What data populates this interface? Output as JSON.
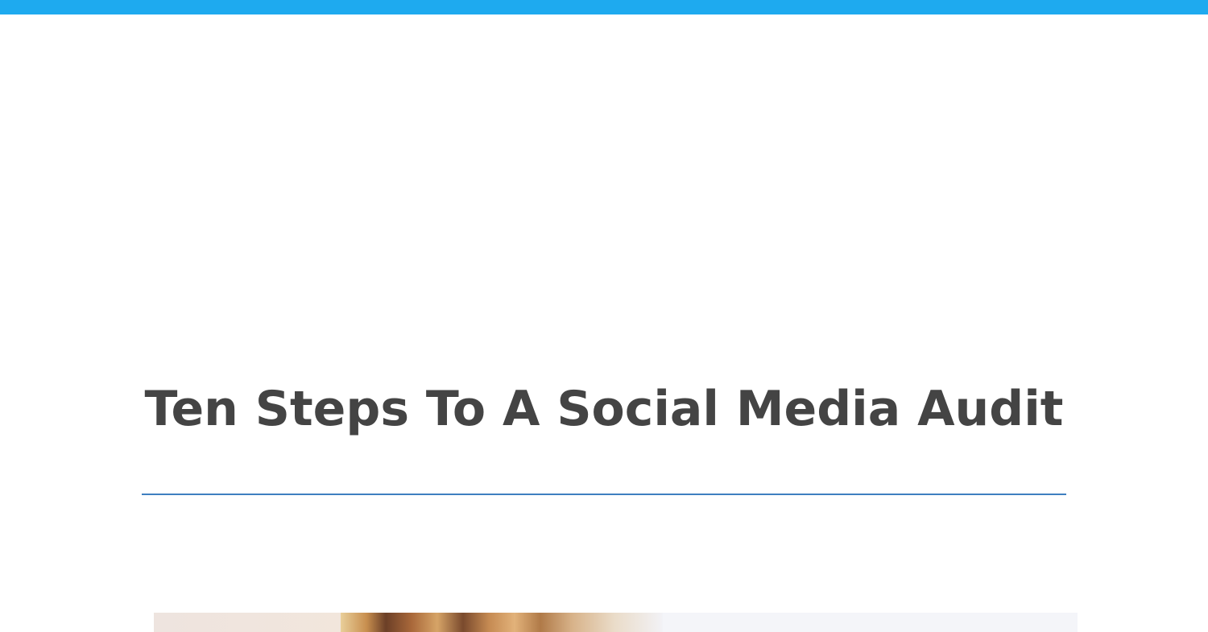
{
  "article": {
    "title": "Ten Steps To A Social Media Audit"
  },
  "colors": {
    "top_bar": "#1eaaef",
    "title_text": "#444444",
    "divider": "#3f7fc0",
    "background": "#ffffff"
  },
  "hero_image": {
    "description_icon": "photo-of-person-with-blonde-hair"
  }
}
